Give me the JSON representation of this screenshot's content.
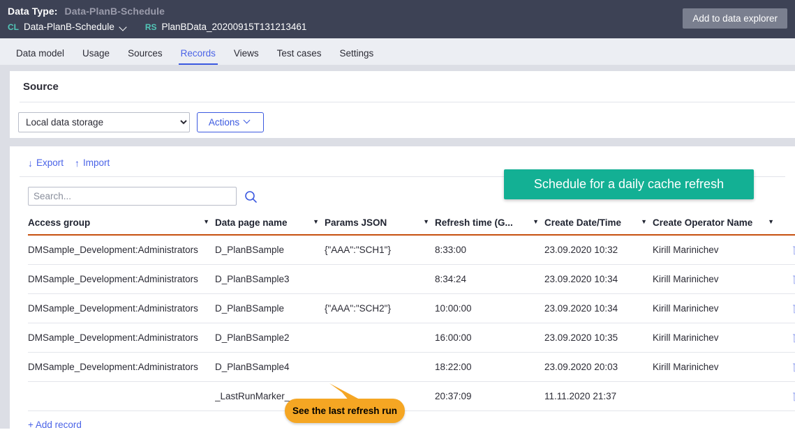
{
  "header": {
    "data_type_label": "Data Type:",
    "data_type_value": "Data-PlanB-Schedule",
    "class_tag": "CL",
    "class_name": "Data-PlanB-Schedule",
    "ruleset_tag": "RS",
    "ruleset_name": "PlanBData_20200915T131213461",
    "add_explorer_button": "Add to data explorer",
    "bg_color": "#3d4255",
    "tag_color": "#52c7b8"
  },
  "tabs": [
    {
      "label": "Data model",
      "active": false
    },
    {
      "label": "Usage",
      "active": false
    },
    {
      "label": "Sources",
      "active": false
    },
    {
      "label": "Records",
      "active": true
    },
    {
      "label": "Views",
      "active": false
    },
    {
      "label": "Test cases",
      "active": false
    },
    {
      "label": "Settings",
      "active": false
    }
  ],
  "source": {
    "title": "Source",
    "select_value": "Local data storage",
    "actions_label": "Actions",
    "cta_label": "Schedule for a daily cache refresh",
    "cta_color": "#13b094"
  },
  "records": {
    "export_label": "Export",
    "import_label": "Import",
    "export_icon": "download-arrow-icon",
    "import_icon": "upload-arrow-icon",
    "search_placeholder": "Search...",
    "search_value": "",
    "add_record_label": "+ Add record",
    "columns": [
      {
        "label": "Access group",
        "filter": true
      },
      {
        "label": "Data page name",
        "filter": true
      },
      {
        "label": "Params JSON",
        "filter": true
      },
      {
        "label": "Refresh time (G...",
        "filter": true
      },
      {
        "label": "Create Date/Time",
        "filter": true
      },
      {
        "label": "Create Operator Name",
        "filter": true
      }
    ],
    "rows": [
      {
        "access_group": "DMSample_Development:Administrators",
        "data_page_name": "D_PlanBSample",
        "params_json": "{\"AAA\":\"SCH1\"}",
        "refresh_time": "8:33:00",
        "create_datetime": "23.09.2020 10:32",
        "create_operator": "Kirill Marinichev"
      },
      {
        "access_group": "DMSample_Development:Administrators",
        "data_page_name": "D_PlanBSample3",
        "params_json": "",
        "refresh_time": "8:34:24",
        "create_datetime": "23.09.2020 10:34",
        "create_operator": "Kirill Marinichev"
      },
      {
        "access_group": "DMSample_Development:Administrators",
        "data_page_name": "D_PlanBSample",
        "params_json": "{\"AAA\":\"SCH2\"}",
        "refresh_time": "10:00:00",
        "create_datetime": "23.09.2020 10:34",
        "create_operator": "Kirill Marinichev"
      },
      {
        "access_group": "DMSample_Development:Administrators",
        "data_page_name": "D_PlanBSample2",
        "params_json": "",
        "refresh_time": "16:00:00",
        "create_datetime": "23.09.2020 10:35",
        "create_operator": "Kirill Marinichev"
      },
      {
        "access_group": "DMSample_Development:Administrators",
        "data_page_name": "D_PlanBSample4",
        "params_json": "",
        "refresh_time": "18:22:00",
        "create_datetime": "23.09.2020 20:03",
        "create_operator": "Kirill Marinichev"
      },
      {
        "access_group": "",
        "data_page_name": "_LastRunMarker_",
        "params_json": "",
        "refresh_time": "20:37:09",
        "create_datetime": "11.11.2020 21:37",
        "create_operator": ""
      }
    ]
  },
  "callout": {
    "text": "See the last refresh run",
    "color": "#f5a623"
  }
}
